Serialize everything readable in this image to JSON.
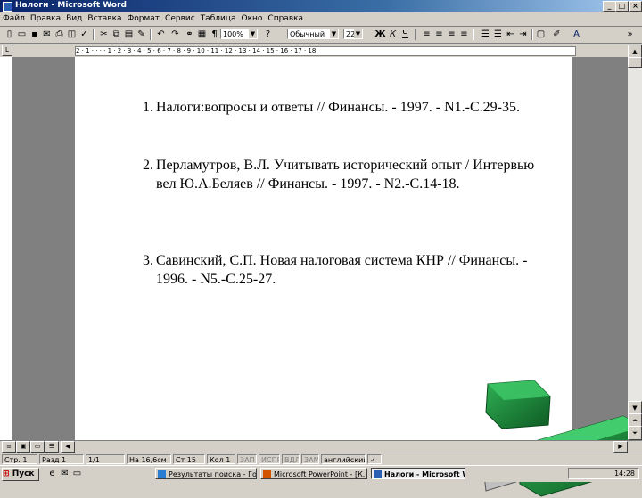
{
  "window": {
    "title": "Налоги - Microsoft Word",
    "minimize": "_",
    "maximize": "□",
    "close": "×"
  },
  "menu": [
    "Файл",
    "Правка",
    "Вид",
    "Вставка",
    "Формат",
    "Сервис",
    "Таблица",
    "Окно",
    "Справка"
  ],
  "toolbar": {
    "zoom": "100%",
    "style": "Обычный",
    "font_size": "22",
    "bold": "Ж",
    "italic": "К",
    "underline": "Ч",
    "pilcrow": "¶"
  },
  "ruler": {
    "marks": "2 · 1 · · · · 1 · 2 · 3 · 4 · 5 · 6 · 7 · 8 · 9 · 10 · 11 · 12 · 13 · 14 · 15 · 16 · 17 · 18"
  },
  "document": {
    "references": [
      {
        "number": "1.",
        "text": "Налоги:вопросы и ответы // Финансы. - 1997. - N1.-С.29-35."
      },
      {
        "number": "2.",
        "text": "Перламутров, В.Л. Учитывать исторический опыт / Интервью вел Ю.А.Беляев // Финансы. - 1997. - N2.-С.14-18."
      },
      {
        "number": "3.",
        "text": "Савинский, С.П. Новая налоговая система КНР // Финансы. - 1996. - N5.-С.25-27."
      }
    ]
  },
  "status": {
    "page": "Стр. 1",
    "section": "Разд 1",
    "pages": "1/1",
    "position": "На 16,6см",
    "line": "Ст 15",
    "column": "Кол 1",
    "rec": "ЗАП",
    "trk": "ИСПР",
    "ext": "ВДЛ",
    "ovr": "ЗАМ",
    "language": "английский (США)"
  },
  "taskbar": {
    "start": "Пуск",
    "tasks": [
      "Результаты поиска - Го...",
      "Microsoft PowerPoint - [К...",
      "Налоги - Microsoft W..."
    ],
    "clock": "14:28"
  },
  "colors": {
    "titlebar": "#0a246a",
    "usb_green": "#1f8a3a"
  }
}
